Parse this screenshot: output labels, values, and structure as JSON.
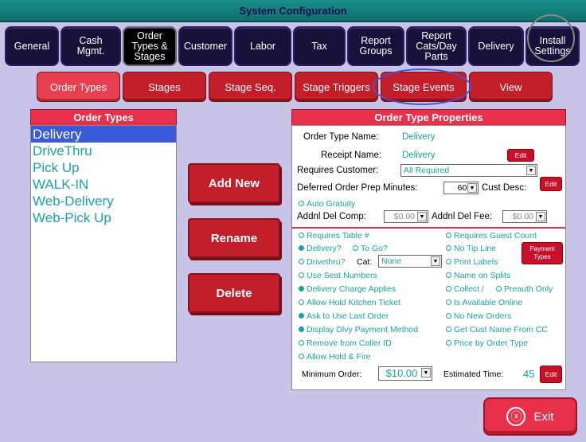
{
  "window": {
    "title": "System Configuration"
  },
  "tabs": [
    {
      "label": "General"
    },
    {
      "label": "Cash\nMgmt."
    },
    {
      "label": "Order\nTypes &\nStages"
    },
    {
      "label": "Customer"
    },
    {
      "label": "Labor"
    },
    {
      "label": "Tax"
    },
    {
      "label": "Report\nGroups"
    },
    {
      "label": "Report\nCats/Day\nParts"
    },
    {
      "label": "Delivery"
    },
    {
      "label": "Install\nSettings"
    }
  ],
  "subtabs": [
    {
      "label": "Order Types"
    },
    {
      "label": "Stages"
    },
    {
      "label": "Stage Seq."
    },
    {
      "label": "Stage Triggers"
    },
    {
      "label": "Stage Events"
    },
    {
      "label": "View"
    }
  ],
  "order_types": {
    "header": "Order Types",
    "items": [
      "Delivery",
      "DriveThru",
      "Pick Up",
      "WALK-IN",
      "Web-Delivery",
      "Web-Pick Up"
    ]
  },
  "buttons": {
    "add_new": "Add New",
    "rename": "Rename",
    "delete": "Delete",
    "exit": "Exit",
    "exit_icon": "ⓧ"
  },
  "props": {
    "header": "Order Type Properties",
    "order_type_name_label": "Order Type Name:",
    "order_type_name": "Delivery",
    "receipt_name_label": "Receipt Name:",
    "receipt_name": "Delivery",
    "edit": "Edit",
    "requires_customer_label": "Requires Customer:",
    "requires_customer": "All Required",
    "deferred_label": "Deferred Order Prep Minutes:",
    "deferred": "60",
    "cust_desc_label": "Cust Desc:",
    "auto_gratuity": "Auto Gratuity",
    "addnl_del_comp_label": "Addnl Del Comp:",
    "addnl_del_comp": "$0.00",
    "addnl_del_fee_label": "Addnl Del Fee:",
    "addnl_del_fee": "$0.00",
    "cat_label": "Cat:",
    "cat": "None",
    "payment_types": "Payment\nTypes",
    "minimum_order_label": "Minimum Order:",
    "minimum_order": "$10.00",
    "estimated_time_label": "Estimated Time:",
    "estimated_time": "45"
  },
  "options": {
    "requires_table": "Requires Table #",
    "delivery": "Delivery?",
    "to_go": "To Go?",
    "drivethru": "Drivethru?",
    "use_seat_numbers": "Use Seat Numbers",
    "delivery_charge": "Delivery Charge Applies",
    "allow_hold_kitchen": "Allow Hold Kitchen Ticket",
    "ask_last_order": "Ask to Use Last Order",
    "display_dlvy": "Display Dlvy Payment Method",
    "remove_caller": "Remove from Caller ID",
    "allow_hold_fire": "Allow Hold & Fire",
    "requires_guest_count": "Requires Guest Count",
    "no_tip_line": "No Tip Line",
    "print_labels": "Print Labels",
    "name_on_splits": "Name on Splits",
    "collect": "Collect /",
    "preauth_only": "Preauth Only",
    "is_available_online": "Is Available Online",
    "no_new_orders": "No New Orders",
    "get_cust_name": "Get Cust Name From CC",
    "price_by_order_type": "Price by Order Type"
  },
  "colors": {
    "accent": "#e8304a",
    "teal": "#1aa3a0",
    "nav": "#17123a"
  }
}
